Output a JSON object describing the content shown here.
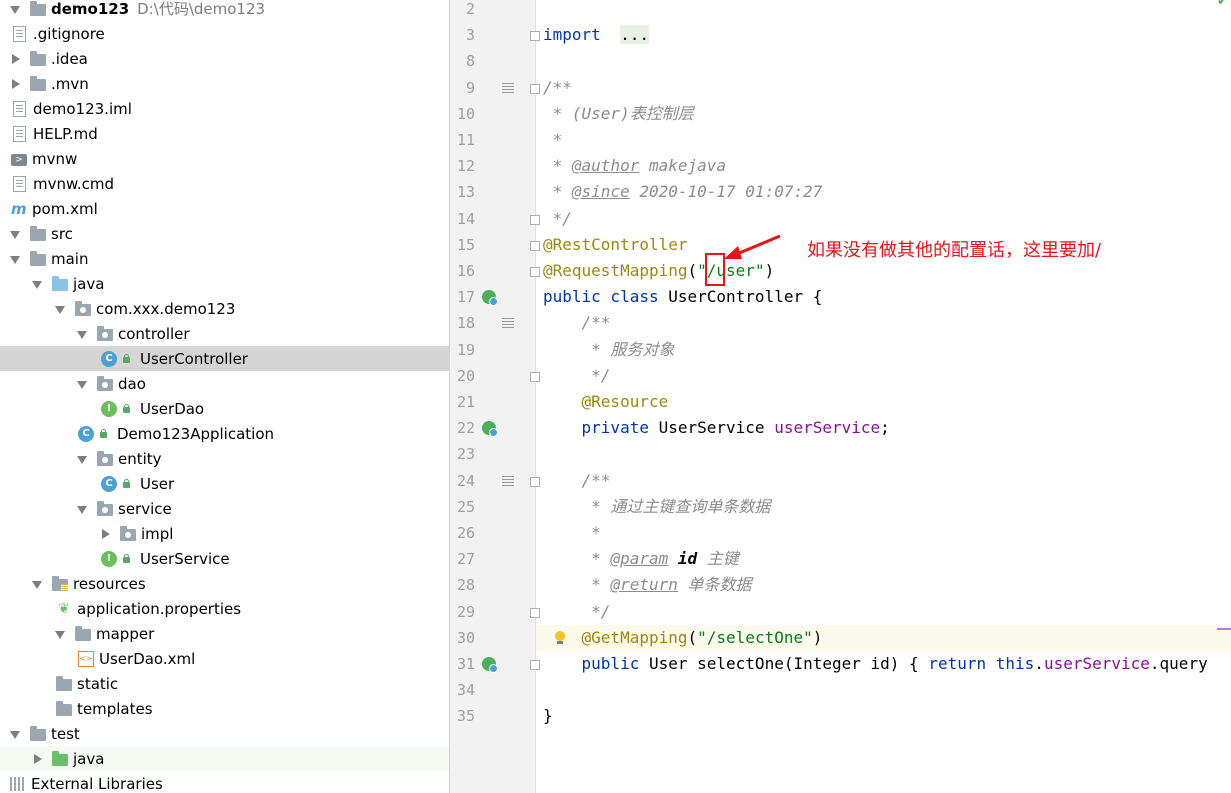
{
  "tree": {
    "rows": [
      {
        "label": "demo123",
        "extra": "D:\\代码\\demo123",
        "icon": "module-folder-icon",
        "arrow": "down",
        "indent": 0,
        "bold": true
      },
      {
        "label": ".gitignore",
        "icon": "ignore-file-icon",
        "arrow": "none",
        "indent": 1
      },
      {
        "label": ".idea",
        "icon": "folder-icon",
        "arrow": "right",
        "indent": 0
      },
      {
        "label": ".mvn",
        "icon": "folder-icon",
        "arrow": "right",
        "indent": 0
      },
      {
        "label": "demo123.iml",
        "icon": "iml-file-icon",
        "arrow": "none",
        "indent": 1
      },
      {
        "label": "HELP.md",
        "icon": "markdown-file-icon",
        "arrow": "none",
        "indent": 1
      },
      {
        "label": "mvnw",
        "icon": "shell-script-icon",
        "arrow": "none",
        "indent": 1
      },
      {
        "label": "mvnw.cmd",
        "icon": "text-file-icon",
        "arrow": "none",
        "indent": 1
      },
      {
        "label": "pom.xml",
        "icon": "maven-icon",
        "arrow": "none",
        "indent": 1
      },
      {
        "label": "src",
        "icon": "folder-icon",
        "arrow": "down",
        "indent": 0
      },
      {
        "label": "main",
        "icon": "folder-icon",
        "arrow": "down",
        "indent": 1
      },
      {
        "label": "java",
        "icon": "source-folder-icon",
        "arrow": "down",
        "indent": 2
      },
      {
        "label": "com.xxx.demo123",
        "icon": "package-icon",
        "arrow": "down",
        "indent": 3
      },
      {
        "label": "controller",
        "icon": "package-icon",
        "arrow": "down",
        "indent": 4
      },
      {
        "label": "UserController",
        "icon": "class-icon",
        "arrow": "none",
        "indent": 5,
        "selected": true,
        "lock": true
      },
      {
        "label": "dao",
        "icon": "package-icon",
        "arrow": "down",
        "indent": 4
      },
      {
        "label": "UserDao",
        "icon": "interface-icon",
        "arrow": "none",
        "indent": 5,
        "lock": true
      },
      {
        "label": "Demo123Application",
        "icon": "spring-app-icon",
        "arrow": "none",
        "indent": 4,
        "lock": true
      },
      {
        "label": "entity",
        "icon": "package-icon",
        "arrow": "down",
        "indent": 4
      },
      {
        "label": "User",
        "icon": "class-icon",
        "arrow": "none",
        "indent": 5,
        "lock": true
      },
      {
        "label": "service",
        "icon": "package-icon",
        "arrow": "down",
        "indent": 4
      },
      {
        "label": "impl",
        "icon": "package-icon",
        "arrow": "right",
        "indent": 5
      },
      {
        "label": "UserService",
        "icon": "interface-icon",
        "arrow": "none",
        "indent": 5,
        "lock": true
      },
      {
        "label": "resources",
        "icon": "resources-folder-icon",
        "arrow": "down",
        "indent": 2
      },
      {
        "label": "application.properties",
        "icon": "spring-properties-icon",
        "arrow": "none",
        "indent": 3
      },
      {
        "label": "mapper",
        "icon": "folder-icon",
        "arrow": "down",
        "indent": 3
      },
      {
        "label": "UserDao.xml",
        "icon": "xml-file-icon",
        "arrow": "none",
        "indent": 4
      },
      {
        "label": "static",
        "icon": "folder-icon",
        "arrow": "none",
        "indent": 3
      },
      {
        "label": "templates",
        "icon": "folder-icon",
        "arrow": "none",
        "indent": 3
      },
      {
        "label": "test",
        "icon": "folder-icon",
        "arrow": "down",
        "indent": 1
      },
      {
        "label": "java",
        "icon": "test-folder-icon",
        "arrow": "right",
        "indent": 2,
        "hover": true
      },
      {
        "label": "External Libraries",
        "icon": "libraries-icon",
        "arrow": "none",
        "indent": 0
      }
    ]
  },
  "editor": {
    "lines": [
      {
        "n": "2",
        "tokens": []
      },
      {
        "n": "3",
        "tokens": [
          [
            "kw",
            "import"
          ],
          [
            "",
            "  "
          ],
          [
            "fold",
            "..."
          ]
        ]
      },
      {
        "n": "8",
        "tokens": []
      },
      {
        "n": "9",
        "tokens": [
          [
            "cm",
            "/**"
          ]
        ]
      },
      {
        "n": "10",
        "tokens": [
          [
            "cm",
            " * (User)表控制层"
          ]
        ]
      },
      {
        "n": "11",
        "tokens": [
          [
            "cm",
            " *"
          ]
        ]
      },
      {
        "n": "12",
        "tokens": [
          [
            "cm",
            " * "
          ],
          [
            "tag",
            "@author"
          ],
          [
            "cm",
            " makejava"
          ]
        ]
      },
      {
        "n": "13",
        "tokens": [
          [
            "cm",
            " * "
          ],
          [
            "tag",
            "@since"
          ],
          [
            "cm",
            " 2020-10-17 01:07:27"
          ]
        ]
      },
      {
        "n": "14",
        "tokens": [
          [
            "cm",
            " */"
          ]
        ]
      },
      {
        "n": "15",
        "tokens": [
          [
            "an",
            "@RestController"
          ]
        ]
      },
      {
        "n": "16",
        "tokens": [
          [
            "an",
            "@RequestMapping"
          ],
          [
            "",
            "("
          ],
          [
            "str",
            "\"/user\""
          ],
          [
            "",
            ")"
          ]
        ]
      },
      {
        "n": "17",
        "tokens": [
          [
            "kw",
            "public class "
          ],
          [
            "",
            "UserController {"
          ]
        ]
      },
      {
        "n": "18",
        "tokens": [
          [
            "cm",
            "    /**"
          ]
        ]
      },
      {
        "n": "19",
        "tokens": [
          [
            "cm",
            "     * 服务对象"
          ]
        ]
      },
      {
        "n": "20",
        "tokens": [
          [
            "cm",
            "     */"
          ]
        ]
      },
      {
        "n": "21",
        "tokens": [
          [
            "an",
            "    @Resource"
          ]
        ]
      },
      {
        "n": "22",
        "tokens": [
          [
            "kw",
            "    private "
          ],
          [
            "",
            "UserService "
          ],
          [
            "fld",
            "userService"
          ],
          [
            "",
            ";"
          ]
        ]
      },
      {
        "n": "23",
        "tokens": []
      },
      {
        "n": "24",
        "tokens": [
          [
            "cm",
            "    /**"
          ]
        ]
      },
      {
        "n": "25",
        "tokens": [
          [
            "cm",
            "     * 通过主键查询单条数据"
          ]
        ]
      },
      {
        "n": "26",
        "tokens": [
          [
            "cm",
            "     *"
          ]
        ]
      },
      {
        "n": "27",
        "tokens": [
          [
            "cm",
            "     * "
          ],
          [
            "tag",
            "@param"
          ],
          [
            "cmb",
            " id"
          ],
          [
            "cm",
            " 主键"
          ]
        ]
      },
      {
        "n": "28",
        "tokens": [
          [
            "cm",
            "     * "
          ],
          [
            "tag",
            "@return"
          ],
          [
            "cm",
            " 单条数据"
          ]
        ]
      },
      {
        "n": "29",
        "tokens": [
          [
            "cm",
            "     */"
          ]
        ]
      },
      {
        "n": "30",
        "tokens": [
          [
            "an",
            "    @GetMapping"
          ],
          [
            "",
            "("
          ],
          [
            "str",
            "\"/selectOne\""
          ],
          [
            "",
            ")"
          ]
        ]
      },
      {
        "n": "31",
        "tokens": [
          [
            "kw",
            "    public "
          ],
          [
            "",
            "User selectOne(Integer id) { "
          ],
          [
            "kw",
            "return this"
          ],
          [
            "",
            "."
          ],
          [
            "fld",
            "userService"
          ],
          [
            "",
            ".query"
          ]
        ]
      },
      {
        "n": "34",
        "tokens": []
      },
      {
        "n": "35",
        "tokens": [
          [
            "",
            "}"
          ]
        ]
      }
    ]
  },
  "annotation": {
    "text": "如果没有做其他的配置话，这里要加/",
    "color": "#e8141a"
  }
}
